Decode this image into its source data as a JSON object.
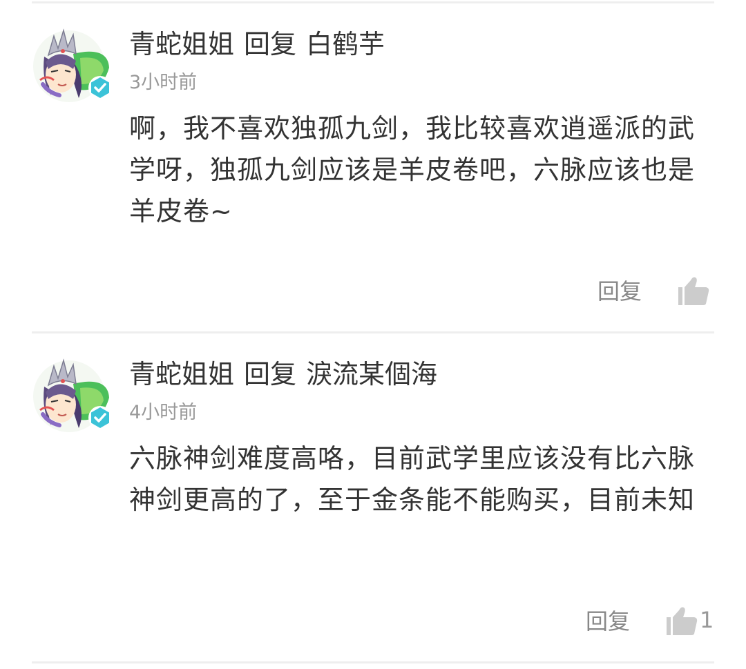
{
  "comments": [
    {
      "author": "青蛇姐姐",
      "action": "回复",
      "reply_to": "白鹤芋",
      "time": "3小时前",
      "text": "啊，我不喜欢独孤九剑，我比较喜欢逍遥派的武学呀，独孤九剑应该是羊皮卷吧，六脉应该也是羊皮卷~",
      "reply_label": "回复",
      "like_count": ""
    },
    {
      "author": "青蛇姐姐",
      "action": "回复",
      "reply_to": "淚流某個海",
      "time": "4小时前",
      "text": "六脉神剑难度高咯，目前武学里应该没有比六脉神剑更高的了，至于金条能不能购买，目前未知",
      "reply_label": "回复",
      "like_count": "1"
    }
  ],
  "colors": {
    "text": "#333333",
    "muted": "#999999",
    "verified_badge": "#3cc3d8",
    "divider": "#eeeeee",
    "like_icon": "#cccccc"
  },
  "icons": {
    "avatar": "avatar-illustration",
    "verified": "verified-check-icon",
    "like": "thumbs-up-icon"
  }
}
